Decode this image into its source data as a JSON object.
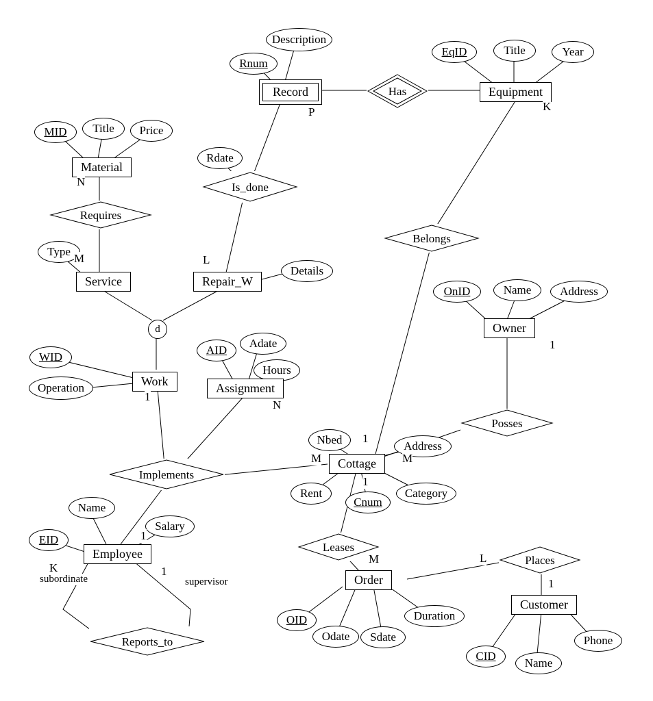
{
  "entities": {
    "record": "Record",
    "equipment": "Equipment",
    "material": "Material",
    "service": "Service",
    "repair_w": "Repair_W",
    "work": "Work",
    "assignment": "Assignment",
    "owner": "Owner",
    "cottage": "Cottage",
    "employee": "Employee",
    "order": "Order",
    "customer": "Customer"
  },
  "relationships": {
    "has": "Has",
    "is_done": "Is_done",
    "requires": "Requires",
    "belongs": "Belongs",
    "posses": "Posses",
    "implements": "Implements",
    "leases": "Leases",
    "places": "Places",
    "reports_to": "Reports_to"
  },
  "attributes": {
    "description": "Description",
    "rnum": "Rnum",
    "eqid": "EqID",
    "title_eq": "Title",
    "year": "Year",
    "mid": "MID",
    "title_mat": "Title",
    "price": "Price",
    "rdate": "Rdate",
    "type": "Type",
    "details": "Details",
    "onid": "OnID",
    "name_owner": "Name",
    "address_owner": "Address",
    "wid": "WID",
    "operation": "Operation",
    "aid": "AID",
    "adate": "Adate",
    "hours": "Hours",
    "nbed": "Nbed",
    "address_cottage": "Address",
    "rent": "Rent",
    "cnum": "Cnum",
    "category": "Category",
    "name_emp": "Name",
    "eid": "EID",
    "salary": "Salary",
    "oid": "OID",
    "odate": "Odate",
    "sdate": "Sdate",
    "duration": "Duration",
    "cid": "CID",
    "name_cust": "Name",
    "phone": "Phone"
  },
  "cardinalities": {
    "record_p": "P",
    "equipment_k": "K",
    "material_n": "N",
    "requires_m": "M",
    "repair_l": "L",
    "work_1": "1",
    "assignment_n": "N",
    "cottage_belongs_1": "1",
    "cottage_implements_m": "M",
    "cottage_posses_m": "M",
    "owner_1": "1",
    "cottage_leases_1": "1",
    "employee_1": "1",
    "employee_k": "K",
    "employee_reports_1": "1",
    "order_m": "M",
    "order_l": "L",
    "customer_1": "1"
  },
  "roles": {
    "subordinate": "subordinate",
    "supervisor": "supervisor"
  },
  "specialization": "d"
}
